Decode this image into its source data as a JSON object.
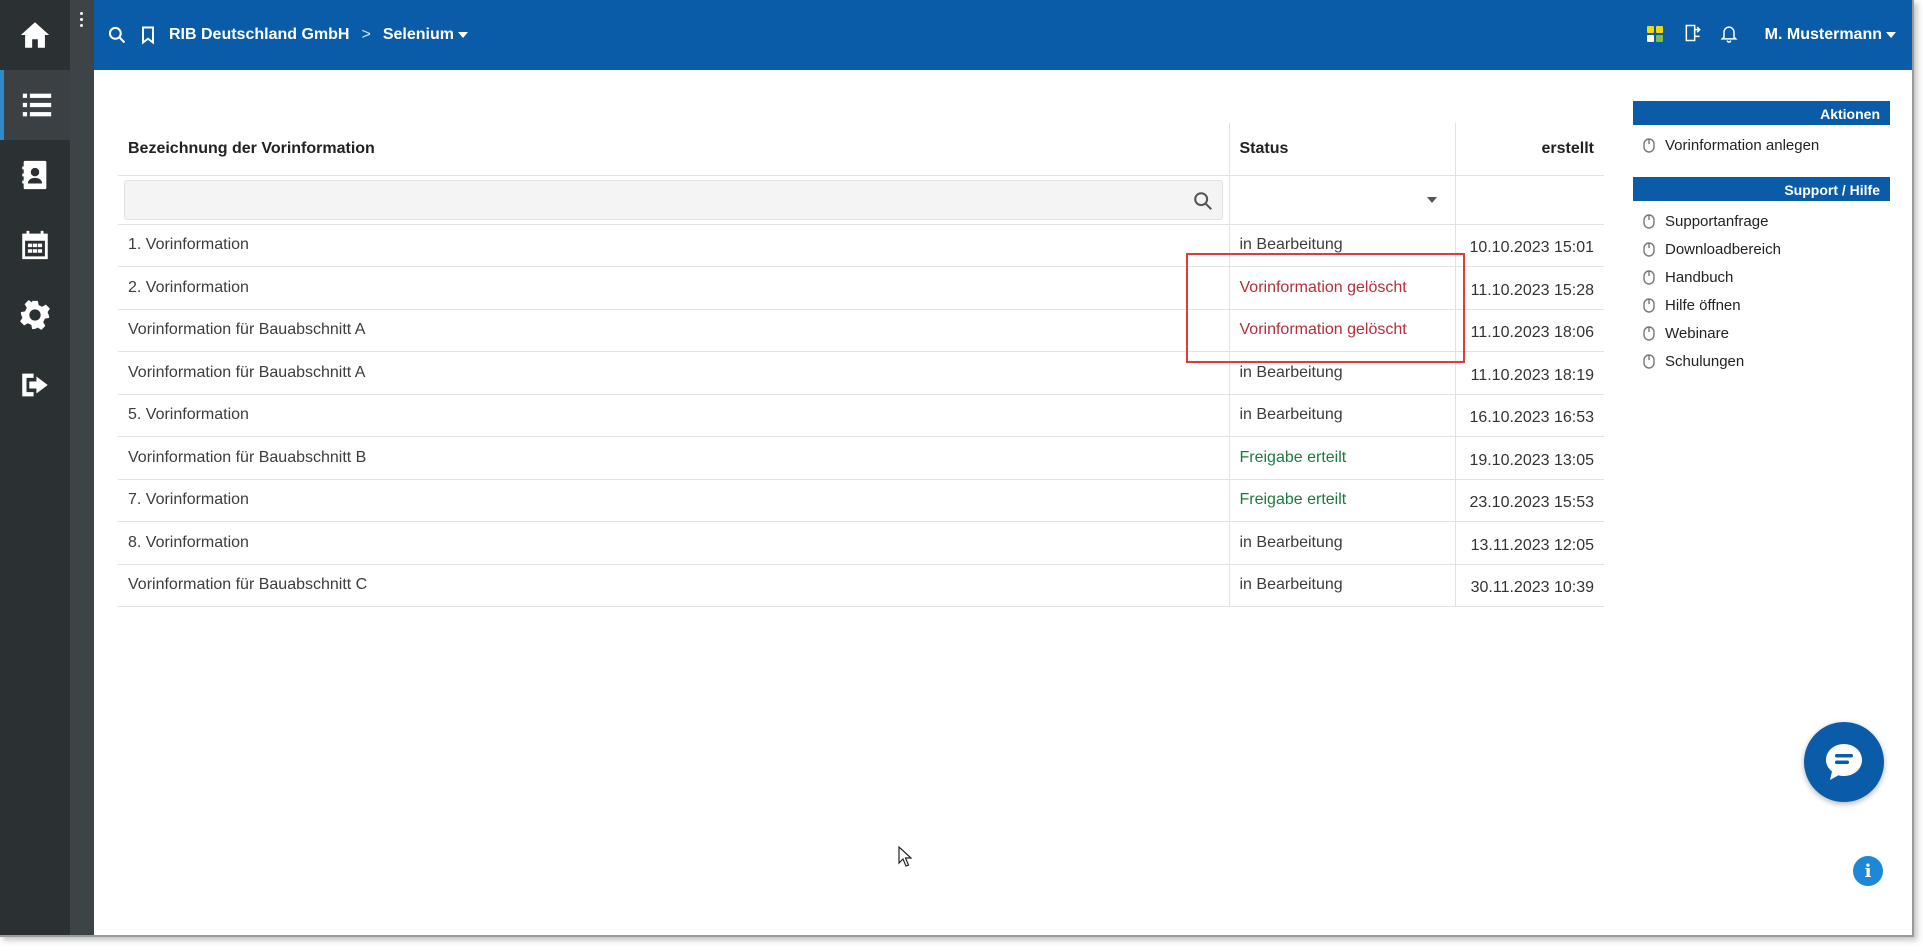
{
  "topbar": {
    "org": "RIB Deutschland GmbH",
    "separator": ">",
    "project": "Selenium",
    "user": "M. Mustermann"
  },
  "table": {
    "columns": {
      "name": "Bezeichnung der Vorinformation",
      "status": "Status",
      "created": "erstellt"
    },
    "filter_placeholder": "",
    "rows": [
      {
        "name": "1. Vorinformation",
        "status": "in Bearbeitung",
        "created": "10.10.2023 15:01",
        "status_kind": "normal"
      },
      {
        "name": "2. Vorinformation",
        "status": "Vorinformation gelöscht",
        "created": "11.10.2023 15:28",
        "status_kind": "deleted"
      },
      {
        "name": "Vorinformation für Bauabschnitt A",
        "status": "Vorinformation gelöscht",
        "created": "11.10.2023 18:06",
        "status_kind": "deleted"
      },
      {
        "name": "Vorinformation für Bauabschnitt A",
        "status": "in Bearbeitung",
        "created": "11.10.2023 18:19",
        "status_kind": "normal"
      },
      {
        "name": "5. Vorinformation",
        "status": "in Bearbeitung",
        "created": "16.10.2023 16:53",
        "status_kind": "normal"
      },
      {
        "name": "Vorinformation für Bauabschnitt B",
        "status": "Freigabe erteilt",
        "created": "19.10.2023 13:05",
        "status_kind": "approved"
      },
      {
        "name": "7. Vorinformation",
        "status": "Freigabe erteilt",
        "created": "23.10.2023 15:53",
        "status_kind": "approved"
      },
      {
        "name": "8. Vorinformation",
        "status": "in Bearbeitung",
        "created": "13.11.2023 12:05",
        "status_kind": "normal"
      },
      {
        "name": "Vorinformation für Bauabschnitt C",
        "status": "in Bearbeitung",
        "created": "30.11.2023 10:39",
        "status_kind": "normal"
      }
    ]
  },
  "side": {
    "actions_title": "Aktionen",
    "actions": [
      "Vorinformation anlegen"
    ],
    "support_title": "Support / Hilfe",
    "support": [
      "Supportanfrage",
      "Downloadbereich",
      "Handbuch",
      "Hilfe öffnen",
      "Webinare",
      "Schulungen"
    ]
  },
  "icons": {
    "rail": [
      "home-icon",
      "list-icon",
      "contacts-icon",
      "calendar-icon",
      "gear-icon",
      "logout-icon"
    ],
    "chat": "chat-icon",
    "info": "info-icon"
  },
  "colors": {
    "brand": "#0a5ca8",
    "rail": "#2b3033",
    "deleted": "#b3303a",
    "approved": "#1d7a3a",
    "highlight": "#e03a3a"
  },
  "info_glyph": "i"
}
